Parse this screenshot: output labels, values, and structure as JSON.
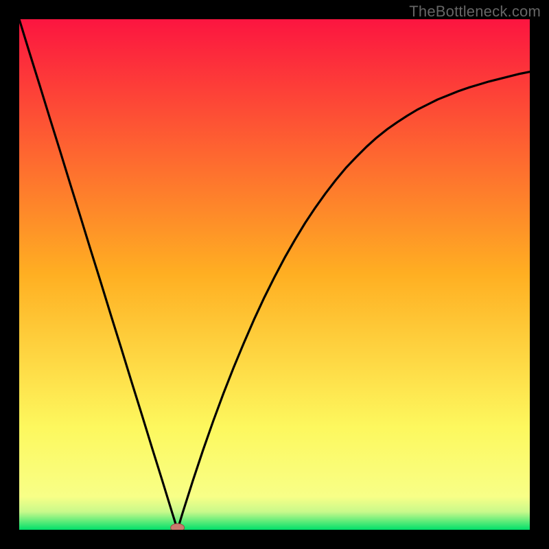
{
  "watermark": "TheBottleneck.com",
  "colors": {
    "frame": "#000000",
    "grad_top": "#fc1540",
    "grad_mid": "#ffaf22",
    "grad_low": "#fdf85e",
    "grad_bottom": "#00e06a",
    "curve": "#000000",
    "marker_fill": "#c97a6f",
    "marker_stroke": "#9a4a3e"
  },
  "chart_data": {
    "type": "line",
    "title": "",
    "xlabel": "",
    "ylabel": "",
    "xlim": [
      0,
      1
    ],
    "ylim": [
      0,
      1
    ],
    "min_point": {
      "x": 0.31,
      "y": 0.0
    },
    "series": [
      {
        "name": "curve",
        "x": [
          0.0,
          0.02,
          0.04,
          0.06,
          0.08,
          0.1,
          0.12,
          0.14,
          0.16,
          0.18,
          0.2,
          0.22,
          0.24,
          0.26,
          0.28,
          0.3,
          0.31,
          0.32,
          0.34,
          0.36,
          0.38,
          0.4,
          0.42,
          0.44,
          0.46,
          0.48,
          0.5,
          0.52,
          0.54,
          0.56,
          0.58,
          0.6,
          0.62,
          0.64,
          0.66,
          0.68,
          0.7,
          0.72,
          0.74,
          0.76,
          0.78,
          0.8,
          0.82,
          0.84,
          0.86,
          0.88,
          0.9,
          0.92,
          0.94,
          0.96,
          0.98,
          1.0
        ],
        "y": [
          1.0,
          0.935,
          0.871,
          0.806,
          0.742,
          0.677,
          0.613,
          0.548,
          0.484,
          0.419,
          0.355,
          0.29,
          0.226,
          0.161,
          0.097,
          0.032,
          0.0,
          0.033,
          0.096,
          0.156,
          0.213,
          0.267,
          0.318,
          0.366,
          0.412,
          0.455,
          0.495,
          0.533,
          0.568,
          0.601,
          0.631,
          0.659,
          0.685,
          0.709,
          0.73,
          0.75,
          0.768,
          0.784,
          0.798,
          0.811,
          0.823,
          0.833,
          0.843,
          0.851,
          0.859,
          0.866,
          0.872,
          0.878,
          0.883,
          0.888,
          0.893,
          0.897
        ]
      }
    ],
    "gradient_stops": [
      {
        "offset": 0.0,
        "color": "#fc1540"
      },
      {
        "offset": 0.5,
        "color": "#ffaf22"
      },
      {
        "offset": 0.8,
        "color": "#fdf85e"
      },
      {
        "offset": 0.935,
        "color": "#f8ff87"
      },
      {
        "offset": 0.965,
        "color": "#c8f98b"
      },
      {
        "offset": 1.0,
        "color": "#00e06a"
      }
    ]
  }
}
